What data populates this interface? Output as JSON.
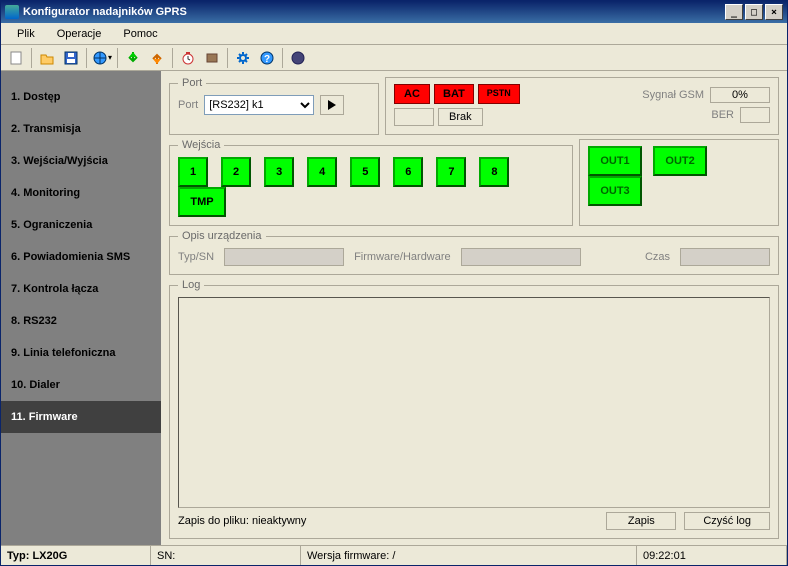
{
  "title": "Konfigurator nadajników GPRS",
  "menubar": {
    "plik": "Plik",
    "operacje": "Operacje",
    "pomoc": "Pomoc"
  },
  "sidebar": {
    "items": [
      {
        "label": "1. Dostęp"
      },
      {
        "label": "2. Transmisja"
      },
      {
        "label": "3. Wejścia/Wyjścia"
      },
      {
        "label": "4. Monitoring"
      },
      {
        "label": "5. Ograniczenia"
      },
      {
        "label": "6. Powiadomienia SMS"
      },
      {
        "label": "7. Kontrola łącza"
      },
      {
        "label": "8. RS232"
      },
      {
        "label": "9. Linia telefoniczna"
      },
      {
        "label": "10. Dialer"
      },
      {
        "label": "11. Firmware"
      }
    ],
    "active_index": 10
  },
  "port": {
    "legend": "Port",
    "label": "Port",
    "value": "[RS232] k1"
  },
  "status": {
    "ac": "AC",
    "bat": "BAT",
    "pstn": "PSTN",
    "brak": "Brak",
    "gsm_label": "Sygnał GSM",
    "gsm_value": "0%",
    "ber_label": "BER"
  },
  "inputs": {
    "legend": "Wejścia",
    "items": [
      "1",
      "2",
      "3",
      "4",
      "5",
      "6",
      "7",
      "8"
    ],
    "tmp": "TMP"
  },
  "outputs": {
    "items": [
      "OUT1",
      "OUT2",
      "OUT3"
    ]
  },
  "desc": {
    "legend": "Opis urządzenia",
    "typsn": "Typ/SN",
    "fwhw": "Firmware/Hardware",
    "czas": "Czas"
  },
  "log": {
    "legend": "Log",
    "file_status": "Zapis do pliku: nieaktywny",
    "save_btn": "Zapis",
    "clear_btn": "Czyść log"
  },
  "statusbar": {
    "typ": "Typ: LX20G",
    "sn": "SN:",
    "fw": "Wersja firmware: /",
    "time": "09:22:01"
  }
}
